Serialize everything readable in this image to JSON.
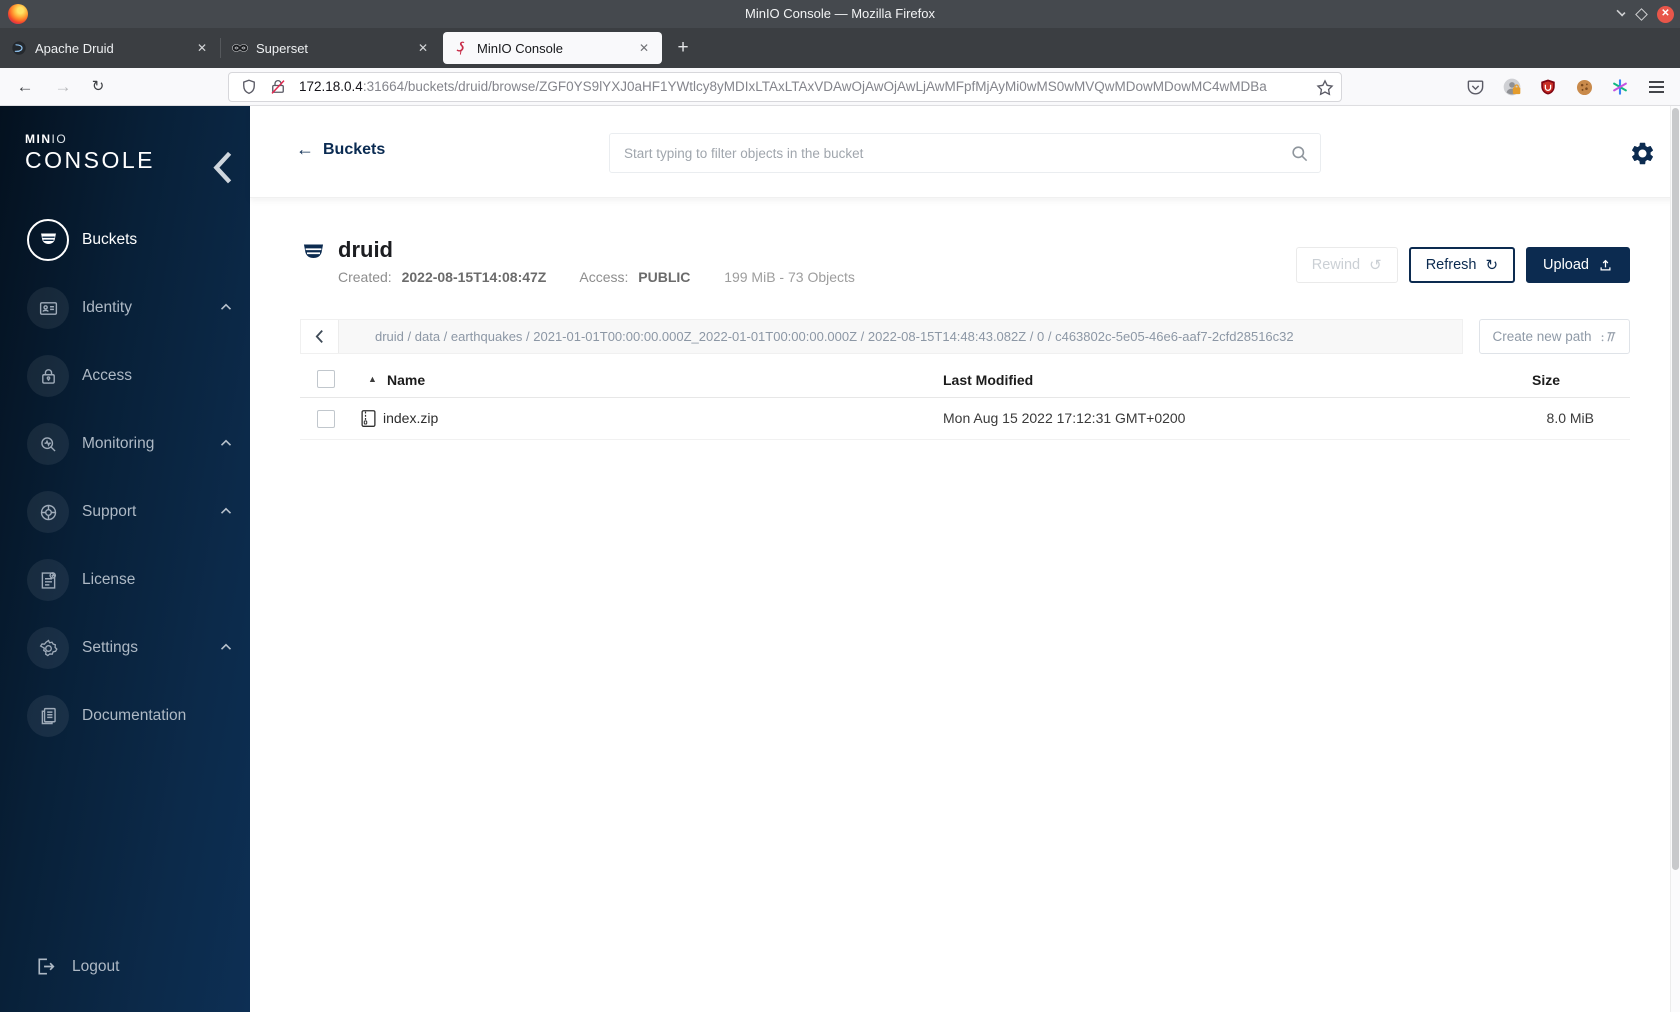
{
  "window": {
    "title": "MinIO Console — Mozilla Firefox",
    "tabs": [
      {
        "label": "Apache Druid",
        "icon": "druid-favicon",
        "active": false
      },
      {
        "label": "Superset",
        "icon": "superset-favicon",
        "active": false
      },
      {
        "label": "MinIO Console",
        "icon": "minio-flamingo-favicon",
        "active": true
      }
    ],
    "new_tab_label": "+",
    "url_host": "172.18.0.4",
    "url_rest": ":31664/buckets/druid/browse/ZGF0YS9lYXJ0aHF1YWtlcy8yMDIxLTAxLTAxVDAwOjAwOjAwLjAwMFpfMjAyMi0wMS0wMVQwMDowMDowMC4wMDBa"
  },
  "sidebar": {
    "brand_min": "MIN",
    "brand_io": "IO",
    "brand_console": "CONSOLE",
    "items": [
      {
        "label": "Buckets",
        "icon": "bucket-icon",
        "active": true,
        "expandable": false
      },
      {
        "label": "Identity",
        "icon": "identity-card-icon",
        "active": false,
        "expandable": true
      },
      {
        "label": "Access",
        "icon": "lock-icon",
        "active": false,
        "expandable": false
      },
      {
        "label": "Monitoring",
        "icon": "magnifier-pulse-icon",
        "active": false,
        "expandable": true
      },
      {
        "label": "Support",
        "icon": "lifebuoy-icon",
        "active": false,
        "expandable": true
      },
      {
        "label": "License",
        "icon": "license-doc-icon",
        "active": false,
        "expandable": false
      },
      {
        "label": "Settings",
        "icon": "gear-icon",
        "active": false,
        "expandable": true
      },
      {
        "label": "Documentation",
        "icon": "book-icon",
        "active": false,
        "expandable": false
      }
    ],
    "logout": {
      "label": "Logout",
      "icon": "logout-icon"
    }
  },
  "header": {
    "back_label": "Buckets",
    "search_placeholder": "Start typing to filter objects in the bucket"
  },
  "bucket": {
    "name": "druid",
    "created_label": "Created:",
    "created_value": "2022-08-15T14:08:47Z",
    "access_label": "Access:",
    "access_value": "PUBLIC",
    "usage": "199 MiB - 73 Objects",
    "actions": {
      "rewind": "Rewind",
      "refresh": "Refresh",
      "upload": "Upload"
    }
  },
  "browser": {
    "path_segments": [
      "druid",
      "data",
      "earthquakes",
      "2021-01-01T00:00:00.000Z_2022-01-01T00:00:00.000Z",
      "2022-08-15T14:48:43.082Z",
      "0",
      "c463802c-5e05-46e6-aaf7-2cfd28516c32"
    ],
    "path_display": "druid / data / earthquakes / 2021-01-01T00:00:00.000Z_2022-01-01T00:00:00.000Z / 2022-08-15T14:48:43.082Z / 0 / c463802c-5e05-46e6-aaf7-2cfd28516c32",
    "create_path_label": "Create new path",
    "columns": {
      "name": "Name",
      "modified": "Last Modified",
      "size": "Size"
    },
    "objects": [
      {
        "name": "index.zip",
        "modified": "Mon Aug 15 2022 17:12:31 GMT+0200",
        "size": "8.0 MiB"
      }
    ]
  },
  "colors": {
    "accent_navy": "#0c2b50",
    "minio_red": "#c72c48",
    "sidebar_gradient_start": "#04111f",
    "sidebar_gradient_end": "#0d2f54",
    "close_button_red": "#e8564a"
  }
}
